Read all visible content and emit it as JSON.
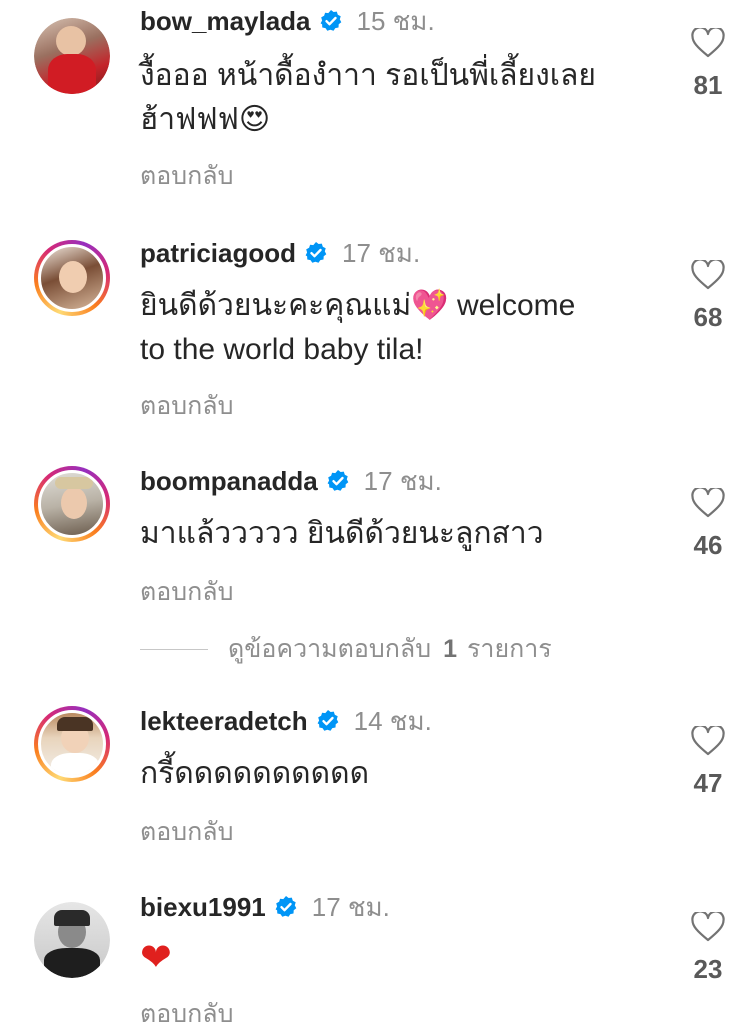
{
  "colors": {
    "username": "#262626",
    "meta": "#8e8e8e",
    "verified": "#0095f6",
    "heart": "#e0201e"
  },
  "comments": [
    {
      "username": "bow_maylada",
      "time": "15 ชม.",
      "text_lines": [
        "งื้อออ หน้าดื้องำาา รอเป็นพี่เลี้ยงเลย",
        "ฮ้าฟฟฟ😍"
      ],
      "reply_label": "ตอบกลับ",
      "likes": "81",
      "verified_icon": "verified-badge-icon",
      "like_icon": "heart-outline-icon"
    },
    {
      "username": "patriciagood",
      "time": "17 ชม.",
      "text_lines": [
        "ยินดีด้วยนะคะคุณแม่💖 welcome",
        "to the world baby tila!"
      ],
      "reply_label": "ตอบกลับ",
      "likes": "68",
      "verified_icon": "verified-badge-icon",
      "like_icon": "heart-outline-icon"
    },
    {
      "username": "boompanadda",
      "time": "17 ชม.",
      "text_lines": [
        "มาแล้ววววว ยินดีด้วยนะลูกสาว"
      ],
      "reply_label": "ตอบกลับ",
      "likes": "46",
      "verified_icon": "verified-badge-icon",
      "like_icon": "heart-outline-icon"
    },
    {
      "username": "lekteeradetch",
      "time": "14 ชม.",
      "text_lines": [
        "กรี้ดดดดดดดดดด"
      ],
      "reply_label": "ตอบกลับ",
      "likes": "47",
      "verified_icon": "verified-badge-icon",
      "like_icon": "heart-outline-icon"
    },
    {
      "username": "biexu1991",
      "time": "17 ชม.",
      "text_lines": [
        "❤"
      ],
      "reply_label": "ตอบกลับ",
      "likes": "23",
      "verified_icon": "verified-badge-icon",
      "like_icon": "heart-outline-icon"
    }
  ],
  "view_replies": {
    "label": "ดูข้อความตอบกลับ",
    "count": "1",
    "suffix": "รายการ"
  }
}
